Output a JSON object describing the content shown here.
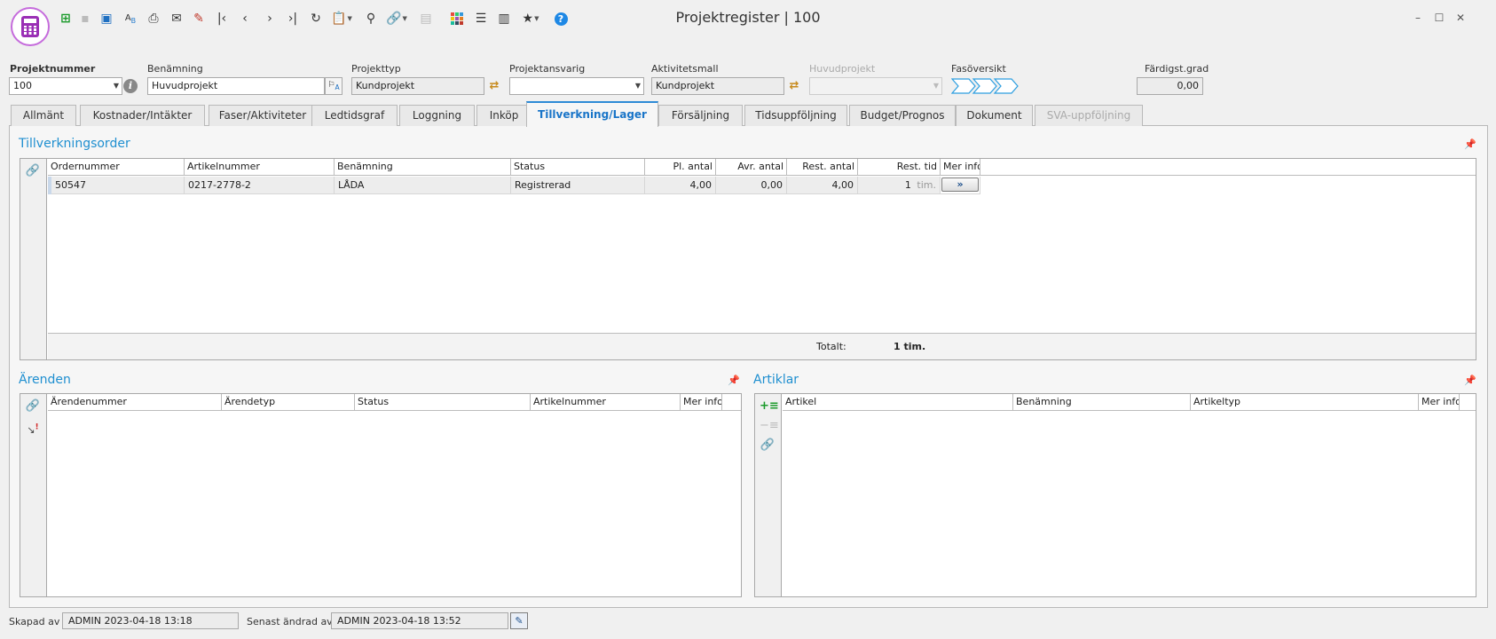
{
  "window": {
    "title": "Projektregister | 100",
    "controls": {
      "minimize": "–",
      "maximize": "☐",
      "close": "✕"
    }
  },
  "toolbar": {
    "icons": [
      "new-record-icon",
      "save-icon",
      "save-as-icon",
      "spellcheck-icon",
      "print-icon",
      "email-icon",
      "export-icon",
      "first-record-icon",
      "previous-record-icon",
      "next-record-icon",
      "last-record-icon",
      "refresh-icon",
      "clipboard-menu-icon",
      "search-icon",
      "link-menu-icon",
      "panel-icon",
      "color-grid-icon",
      "settings-sliders-icon",
      "book-icon",
      "favorites-icon",
      "help-icon"
    ]
  },
  "header": {
    "projektnummer": {
      "label": "Projektnummer",
      "value": "100"
    },
    "benamning": {
      "label": "Benämning",
      "value": "Huvudprojekt"
    },
    "projekttyp": {
      "label": "Projekttyp",
      "value": "Kundprojekt"
    },
    "projektansvarig": {
      "label": "Projektansvarig",
      "value": ""
    },
    "aktivitetsmall": {
      "label": "Aktivitetsmall",
      "value": "Kundprojekt"
    },
    "huvudprojekt": {
      "label": "Huvudprojekt",
      "value": ""
    },
    "fasoversikt": {
      "label": "Fasöversikt",
      "steps": 3,
      "color": "#2c9ee0"
    },
    "fardigstgrad": {
      "label": "Färdigst.grad",
      "value": "0,00"
    }
  },
  "tabs": [
    {
      "label": "Allmänt",
      "state": "normal"
    },
    {
      "label": "Kostnader/Intäkter",
      "state": "normal"
    },
    {
      "label": "Faser/Aktiviteter",
      "state": "normal"
    },
    {
      "label": "Ledtidsgraf",
      "state": "normal"
    },
    {
      "label": "Loggning",
      "state": "normal"
    },
    {
      "label": "Inköp",
      "state": "normal"
    },
    {
      "label": "Tillverkning/Lager",
      "state": "active"
    },
    {
      "label": "Försäljning",
      "state": "normal"
    },
    {
      "label": "Tidsuppföljning",
      "state": "normal"
    },
    {
      "label": "Budget/Prognos",
      "state": "normal"
    },
    {
      "label": "Dokument",
      "state": "normal"
    },
    {
      "label": "SVA-uppföljning",
      "state": "disabled"
    }
  ],
  "tillverkningsorder": {
    "title": "Tillverkningsorder",
    "columns": [
      "Ordernummer",
      "Artikelnummer",
      "Benämning",
      "Status",
      "Pl. antal",
      "Avr. antal",
      "Rest. antal",
      "Rest. tid",
      "Mer info"
    ],
    "rows": [
      {
        "ordernummer": "50547",
        "artikelnummer": "0217-2778-2",
        "benamning": "LÅDA",
        "status": "Registrerad",
        "pl_antal": "4,00",
        "avr_antal": "0,00",
        "rest_antal": "4,00",
        "rest_tid": "1",
        "rest_tid_unit": "tim.",
        "mer_info": "»"
      }
    ],
    "total_label": "Totalt:",
    "total_value": "1 tim."
  },
  "arenden": {
    "title": "Ärenden",
    "columns": [
      "Ärendenummer",
      "Ärendetyp",
      "Status",
      "Artikelnummer",
      "Mer info"
    ]
  },
  "artiklar": {
    "title": "Artiklar",
    "columns": [
      "Artikel",
      "Benämning",
      "Artikeltyp",
      "Mer info"
    ]
  },
  "footer": {
    "skapad_label": "Skapad av",
    "skapad_value": "ADMIN 2023-04-18 13:18",
    "andrad_label": "Senast ändrad av",
    "andrad_value": "ADMIN 2023-04-18 13:52"
  }
}
